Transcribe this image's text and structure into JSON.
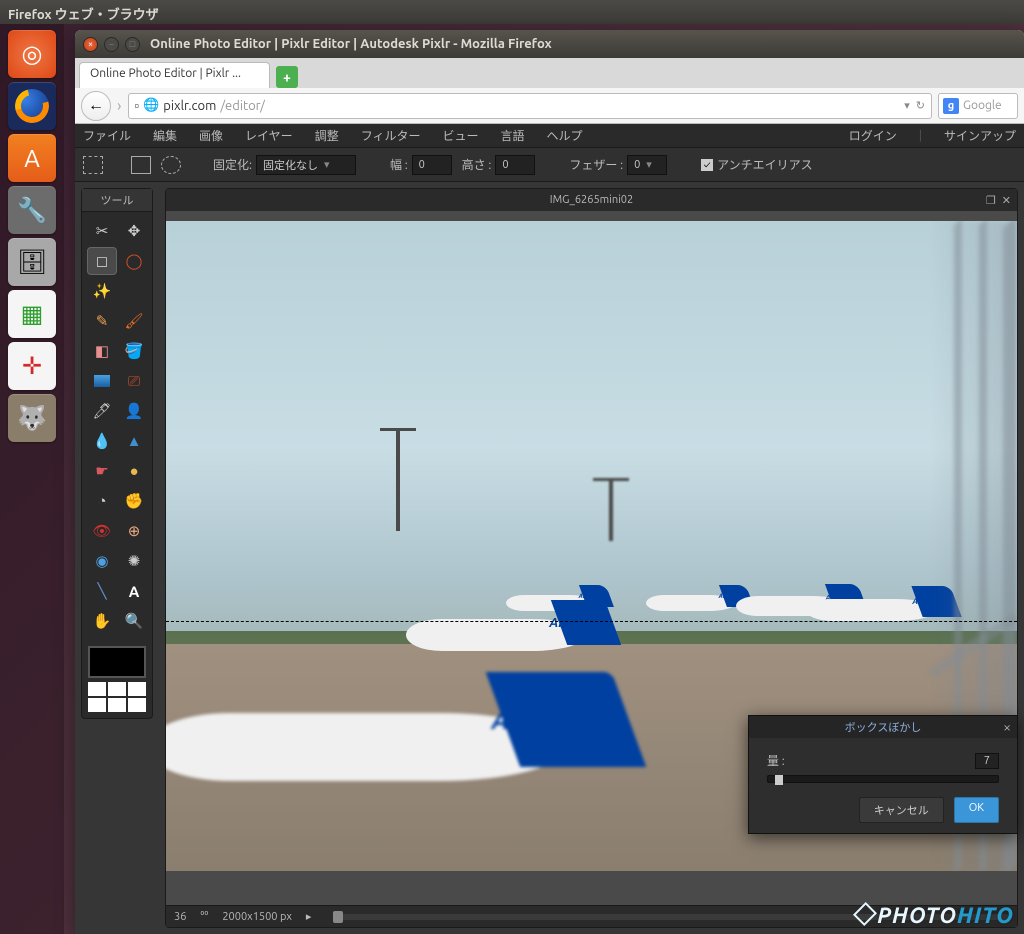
{
  "ubuntu": {
    "topbar_title": "Firefox ウェブ・ブラウザ"
  },
  "browser": {
    "window_title": "Online Photo Editor | Pixlr Editor | Autodesk Pixlr - Mozilla Firefox",
    "tab_label": "Online Photo Editor | Pixlr ...",
    "url_domain": "pixlr.com",
    "url_path": "/editor/",
    "search_placeholder": "Google"
  },
  "pixlr": {
    "menu": [
      "ファイル",
      "編集",
      "画像",
      "レイヤー",
      "調整",
      "フィルター",
      "ビュー",
      "言語",
      "ヘルプ"
    ],
    "right_menu": {
      "login": "ログイン",
      "signup": "サインアップ"
    },
    "options": {
      "fixed_label": "固定化:",
      "fixed_value": "固定化なし",
      "width_label": "幅 :",
      "width_value": "0",
      "height_label": "高さ :",
      "height_value": "0",
      "feather_label": "フェザー :",
      "feather_value": "0",
      "antialias_label": "アンチエイリアス"
    },
    "tools_title": "ツール",
    "image_title": "IMG_6265mini02",
    "status": {
      "zoom": "36",
      "dimensions": "2000x1500 px"
    }
  },
  "dialog": {
    "title": "ボックスぼかし",
    "amount_label": "量 :",
    "amount_value": "7",
    "cancel": "キャンセル",
    "ok": "OK"
  },
  "watermark": {
    "pre": "PHOTO",
    "post": "HITO"
  }
}
